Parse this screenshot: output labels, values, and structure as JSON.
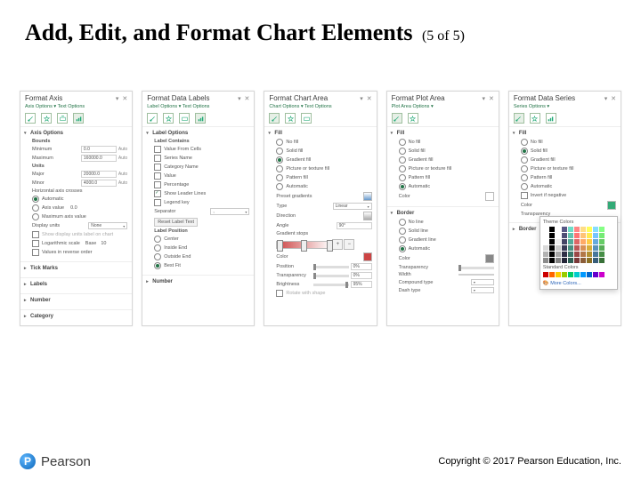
{
  "title": "Add, Edit, and Format Chart Elements",
  "pager": "(5 of 5)",
  "footer": {
    "brand": "Pearson",
    "copyright": "Copyright © 2017 Pearson Education, Inc."
  },
  "panes": [
    {
      "title": "Format Axis",
      "subtools": "Axis Options ▾   Text Options",
      "groups": {
        "axis_options": {
          "heading": "Axis Options",
          "bounds_label": "Bounds",
          "min_label": "Minimum",
          "min_val": "0.0",
          "min_auto": "Auto",
          "max_label": "Maximum",
          "max_val": "160000.0",
          "max_auto": "Auto",
          "units_label": "Units",
          "major_label": "Major",
          "major_val": "20000.0",
          "major_auto": "Auto",
          "minor_label": "Minor",
          "minor_val": "4000.0",
          "minor_auto": "Auto",
          "cross_label": "Horizontal axis crosses",
          "cross_auto": "Automatic",
          "cross_val": "Axis value",
          "cross_val_num": "0.0",
          "cross_max": "Maximum axis value",
          "disp_label": "Display units",
          "disp_val": "None",
          "disp_show": "Show display units label on chart",
          "log_label": "Logarithmic scale",
          "log_base": "Base",
          "log_base_val": "10",
          "rev_label": "Values in reverse order"
        },
        "collapsed": [
          "Tick Marks",
          "Labels",
          "Number",
          "Category"
        ]
      }
    },
    {
      "title": "Format Data Labels",
      "subtools": "Label Options ▾   Text Options",
      "groups": {
        "label_options": {
          "heading": "Label Options",
          "contains": "Label Contains",
          "items": [
            {
              "label": "Value From Cells",
              "checked": false
            },
            {
              "label": "Series Name",
              "checked": false
            },
            {
              "label": "Category Name",
              "checked": false
            },
            {
              "label": "Value",
              "checked": false
            },
            {
              "label": "Percentage",
              "checked": false
            },
            {
              "label": "Show Leader Lines",
              "checked": true
            },
            {
              "label": "Legend key",
              "checked": false
            }
          ],
          "sep_label": "Separator",
          "sep_val": ",",
          "reset": "Reset Label Text",
          "pos_heading": "Label Position",
          "pos": [
            {
              "label": "Center",
              "checked": false
            },
            {
              "label": "Inside End",
              "checked": false
            },
            {
              "label": "Outside End",
              "checked": false
            },
            {
              "label": "Best Fit",
              "checked": true
            }
          ]
        },
        "collapsed": [
          "Number"
        ]
      }
    },
    {
      "title": "Format Chart Area",
      "subtools": "Chart Options ▾   Text Options",
      "groups": {
        "fill": {
          "heading": "Fill",
          "opts": [
            {
              "label": "No fill",
              "checked": false
            },
            {
              "label": "Solid fill",
              "checked": false
            },
            {
              "label": "Gradient fill",
              "checked": true
            },
            {
              "label": "Picture or texture fill",
              "checked": false
            },
            {
              "label": "Pattern fill",
              "checked": false
            },
            {
              "label": "Automatic",
              "checked": false
            }
          ],
          "preset_label": "Preset gradients",
          "type_label": "Type",
          "type_val": "Linear",
          "dir_label": "Direction",
          "angle_label": "Angle",
          "angle_val": "90°",
          "stops_label": "Gradient stops",
          "color_label": "Color",
          "position_label": "Position",
          "position_val": "0%",
          "trans_label": "Transparency",
          "trans_val": "0%",
          "bright_label": "Brightness",
          "bright_val": "95%",
          "rotate_label": "Rotate with shape"
        }
      }
    },
    {
      "title": "Format Plot Area",
      "subtools": "Plot Area Options ▾",
      "groups": {
        "fill": {
          "heading": "Fill",
          "opts": [
            {
              "label": "No fill",
              "checked": false
            },
            {
              "label": "Solid fill",
              "checked": false
            },
            {
              "label": "Gradient fill",
              "checked": false
            },
            {
              "label": "Picture or texture fill",
              "checked": false
            },
            {
              "label": "Pattern fill",
              "checked": false
            },
            {
              "label": "Automatic",
              "checked": true
            }
          ],
          "color_label": "Color"
        },
        "border": {
          "heading": "Border",
          "opts": [
            {
              "label": "No line",
              "checked": false
            },
            {
              "label": "Solid line",
              "checked": false
            },
            {
              "label": "Gradient line",
              "checked": false
            },
            {
              "label": "Automatic",
              "checked": true
            }
          ],
          "color_label": "Color",
          "trans_label": "Transparency",
          "width_label": "Width",
          "comp_label": "Compound type",
          "dash_label": "Dash type"
        }
      }
    },
    {
      "title": "Format Data Series",
      "subtools": "Series Options ▾",
      "groups": {
        "fill": {
          "heading": "Fill",
          "opts": [
            {
              "label": "No fill",
              "checked": false
            },
            {
              "label": "Solid fill",
              "checked": true
            },
            {
              "label": "Gradient fill",
              "checked": false
            },
            {
              "label": "Picture or texture fill",
              "checked": false
            },
            {
              "label": "Pattern fill",
              "checked": false
            },
            {
              "label": "Automatic",
              "checked": false
            },
            {
              "label": "Invert if negative",
              "checked": false
            }
          ],
          "color_label": "Color",
          "trans_label": "Transparency"
        },
        "border_heading": "Border"
      },
      "popup": {
        "theme_label": "Theme Colors",
        "standard_label": "Standard Colors",
        "more_label": "More Colors..."
      }
    }
  ]
}
